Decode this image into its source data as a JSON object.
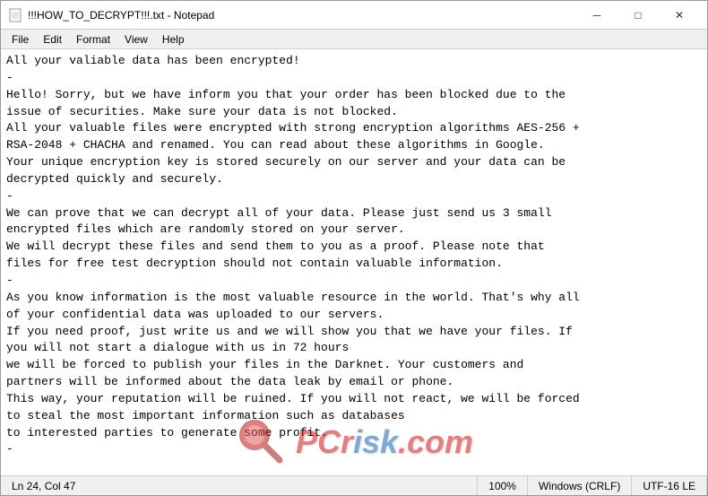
{
  "window": {
    "title": "!!!HOW_TO_DECRYPT!!!.txt - Notepad"
  },
  "title_bar": {
    "icon_char": "📄",
    "minimize_label": "─",
    "maximize_label": "□",
    "close_label": "✕"
  },
  "menu": {
    "items": [
      "File",
      "Edit",
      "Format",
      "View",
      "Help"
    ]
  },
  "content": {
    "text": "All your valiable data has been encrypted!\n-\nHello! Sorry, but we have inform you that your order has been blocked due to the\nissue of securities. Make sure your data is not blocked.\nAll your valuable files were encrypted with strong encryption algorithms AES-256 +\nRSA-2048 + CHACHA and renamed. You can read about these algorithms in Google.\nYour unique encryption key is stored securely on our server and your data can be\ndecrypted quickly and securely.\n-\nWe can prove that we can decrypt all of your data. Please just send us 3 small\nencrypted files which are randomly stored on your server.\nWe will decrypt these files and send them to you as a proof. Please note that\nfiles for free test decryption should not contain valuable information.\n-\nAs you know information is the most valuable resource in the world. That's why all\nof your confidential data was uploaded to our servers.\nIf you need proof, just write us and we will show you that we have your files. If\nyou will not start a dialogue with us in 72 hours\nwe will be forced to publish your files in the Darknet. Your customers and\npartners will be informed about the data leak by email or phone.\nThis way, your reputation will be ruined. If you will not react, we will be forced\nto steal the most important information such as databases\nto interested parties to generate some profit.\n-"
  },
  "status_bar": {
    "position": "Ln 24, Col 47",
    "zoom": "100%",
    "line_ending": "Windows (CRLF)",
    "encoding": "UTF-16 LE"
  },
  "watermark": {
    "site": "PCrisk.com",
    "text_part1": "PCr",
    "text_part2": "isk",
    "text_part3": ".com"
  }
}
